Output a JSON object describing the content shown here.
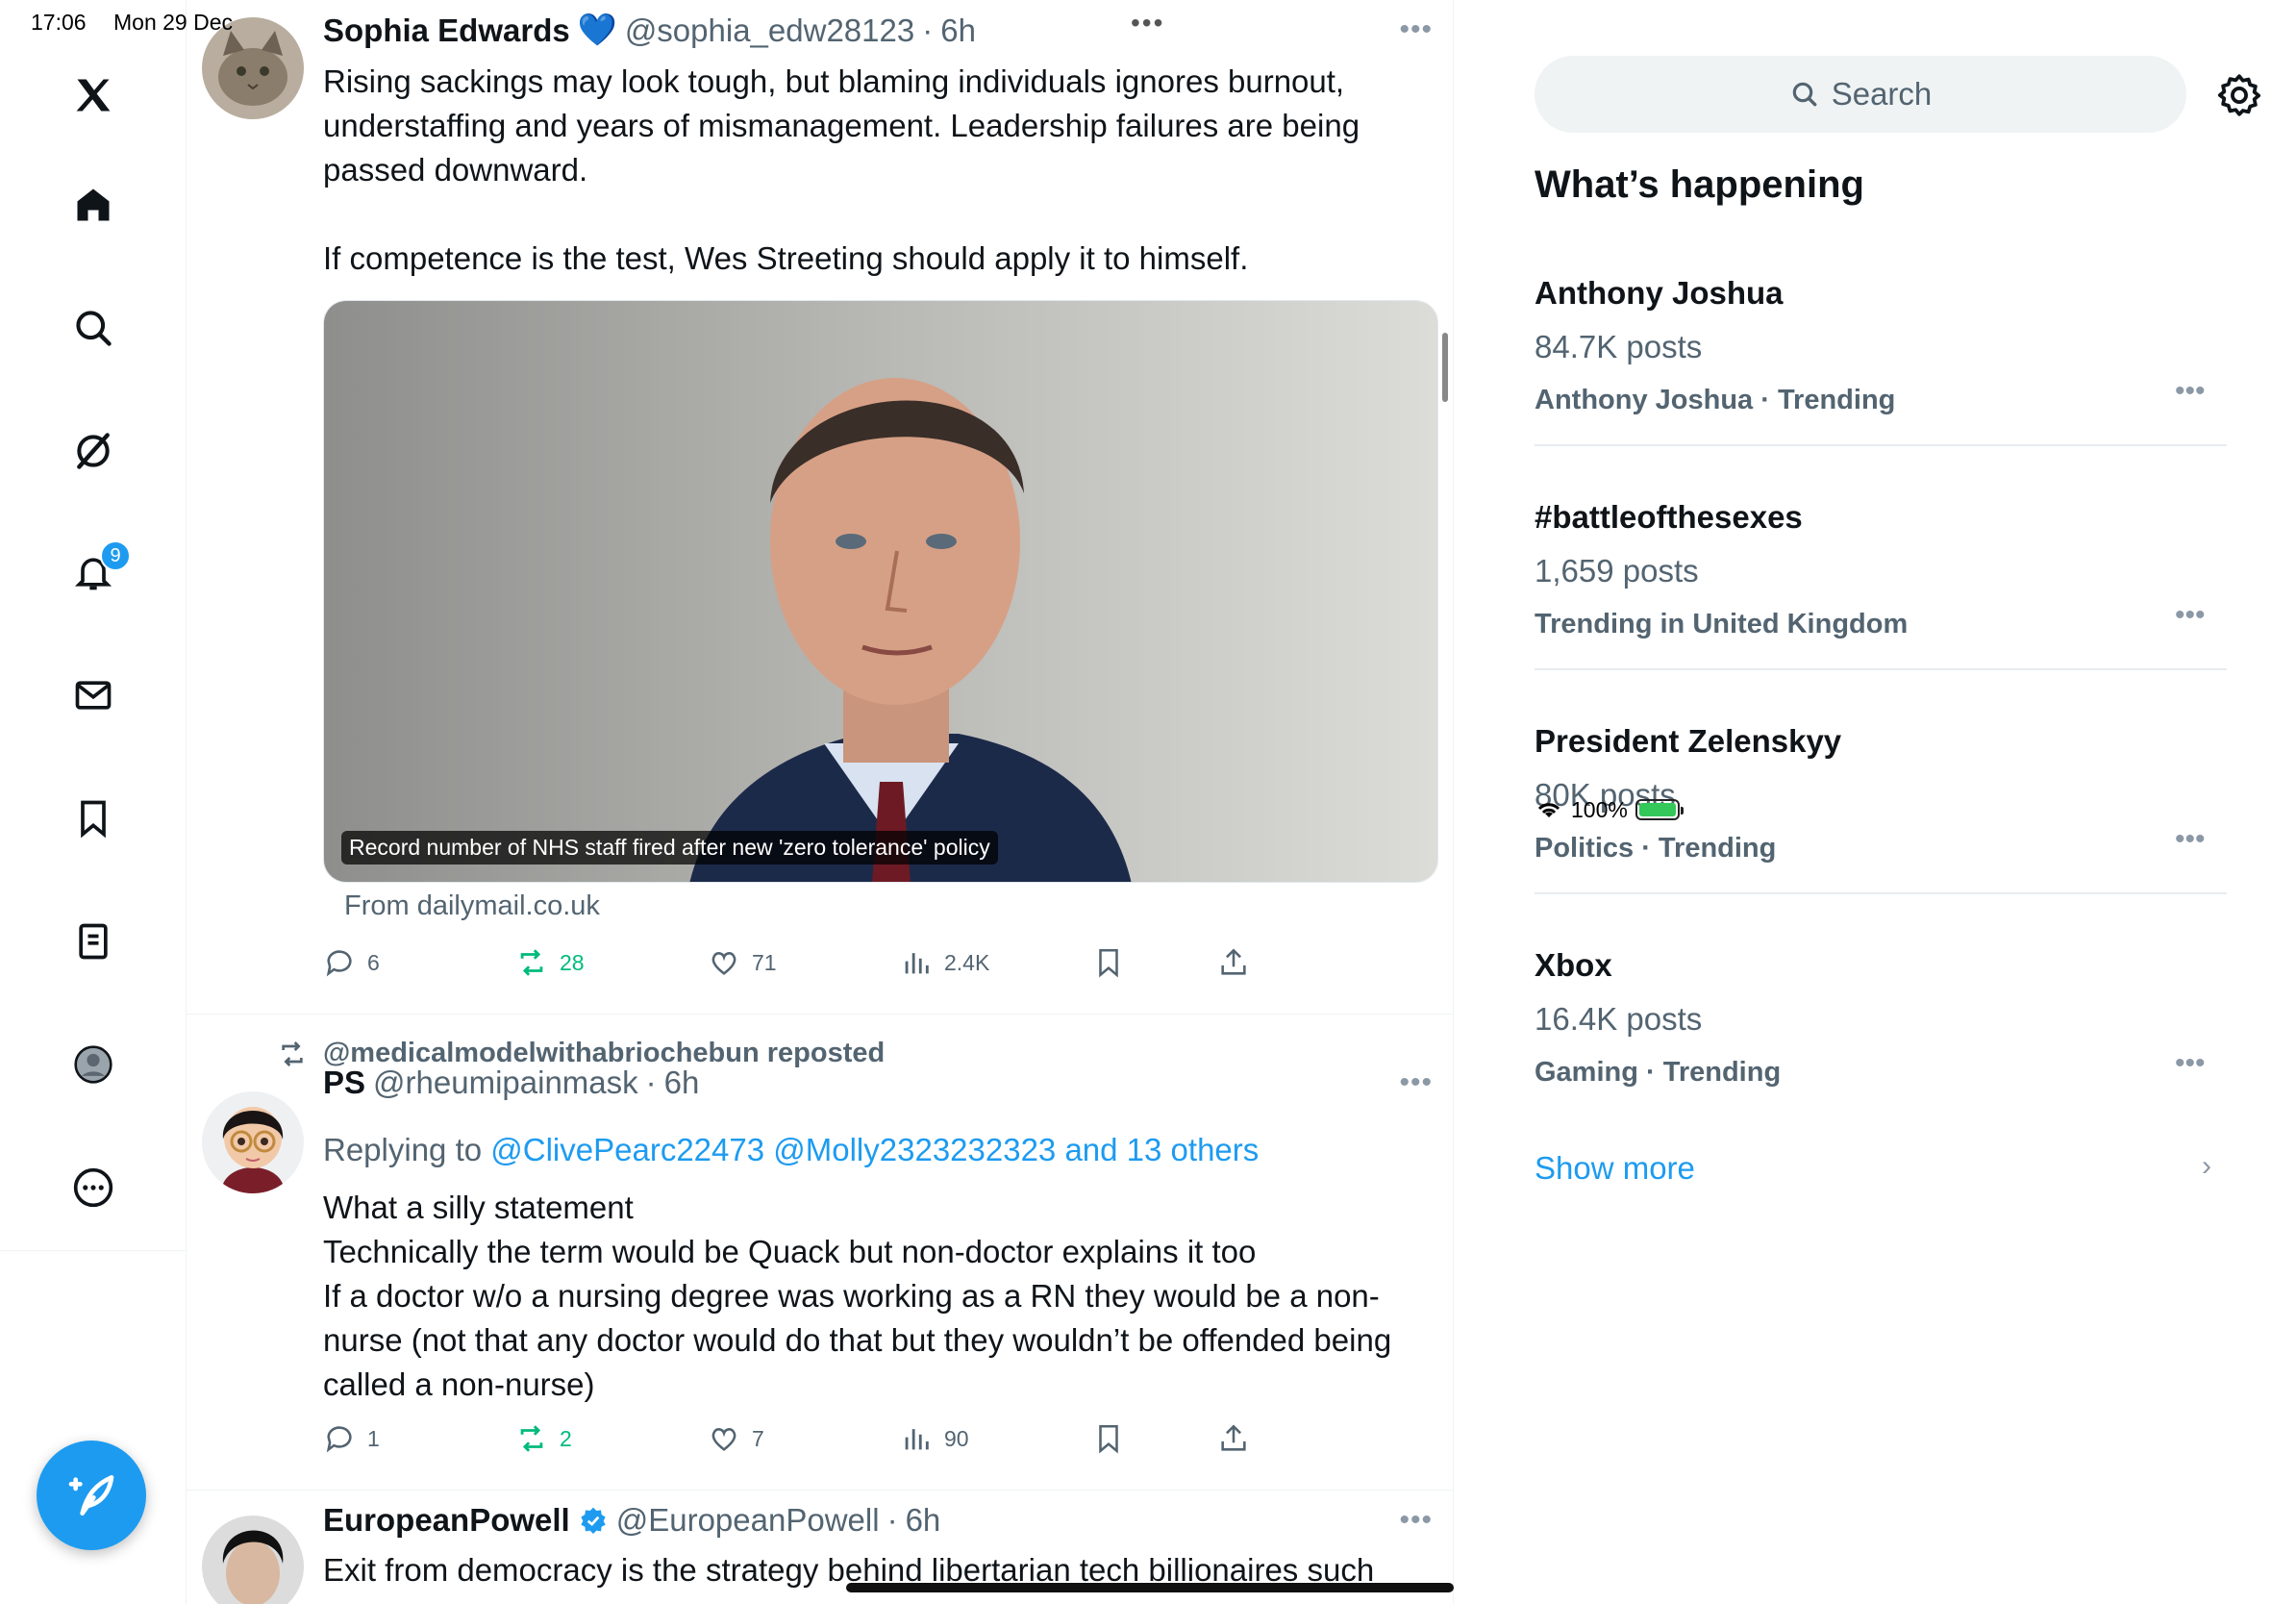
{
  "status": {
    "time": "17:06",
    "date": "Mon 29 Dec",
    "battery": "100%"
  },
  "nav": {
    "notifications_badge": "9"
  },
  "tweets": [
    {
      "name": "Sophia Edwards",
      "emoji": "💙",
      "handle": "@sophia_edw28123",
      "time": "6h",
      "text": "Rising sackings may look tough, but blaming individuals ignores burnout, understaffing and years of mismanagement. Leadership failures are being passed downward.\n\nIf competence is the test, Wes Streeting should apply it to himself.",
      "media_caption": "Record number of NHS staff fired after new 'zero tolerance' policy",
      "source": "From dailymail.co.uk",
      "replies": "6",
      "reposts": "28",
      "likes": "71",
      "views": "2.4K"
    },
    {
      "repost_by": "@medicalmodelwithabriochebun reposted",
      "name": "PS",
      "handle": "@rheumipainmask",
      "time": "6h",
      "reply_prefix": "Replying to ",
      "reply_to": "@ClivePearc22473 @Molly2323232323 and 13 others",
      "text": "What a silly statement\nTechnically the term would be Quack but non-doctor explains it too\nIf a doctor w/o a nursing degree was working as a RN they would be a non-nurse (not that any doctor would do that but they wouldn’t be offended being called a non-nurse)",
      "replies": "1",
      "reposts": "2",
      "likes": "7",
      "views": "90"
    },
    {
      "name": "EuropeanPowell",
      "handle": "@EuropeanPowell",
      "time": "6h",
      "text": "Exit from democracy is the strategy behind libertarian tech billionaires such"
    }
  ],
  "sidebar": {
    "search_placeholder": "Search",
    "title": "What’s happening",
    "trends": [
      {
        "name": "Anthony Joshua",
        "count": "84.7K posts",
        "meta": "Anthony Joshua · Trending"
      },
      {
        "name": "#battleofthesexes",
        "count": "1,659 posts",
        "meta": "Trending in United Kingdom"
      },
      {
        "name": "President Zelenskyy",
        "count": "80K posts",
        "meta": "Politics · Trending"
      },
      {
        "name": "Xbox",
        "count": "16.4K posts",
        "meta": "Gaming · Trending"
      }
    ],
    "show_more": "Show more"
  },
  "colors": {
    "accent": "#1d9bf0",
    "repost_green": "#00ba7c",
    "muted": "#536471"
  }
}
